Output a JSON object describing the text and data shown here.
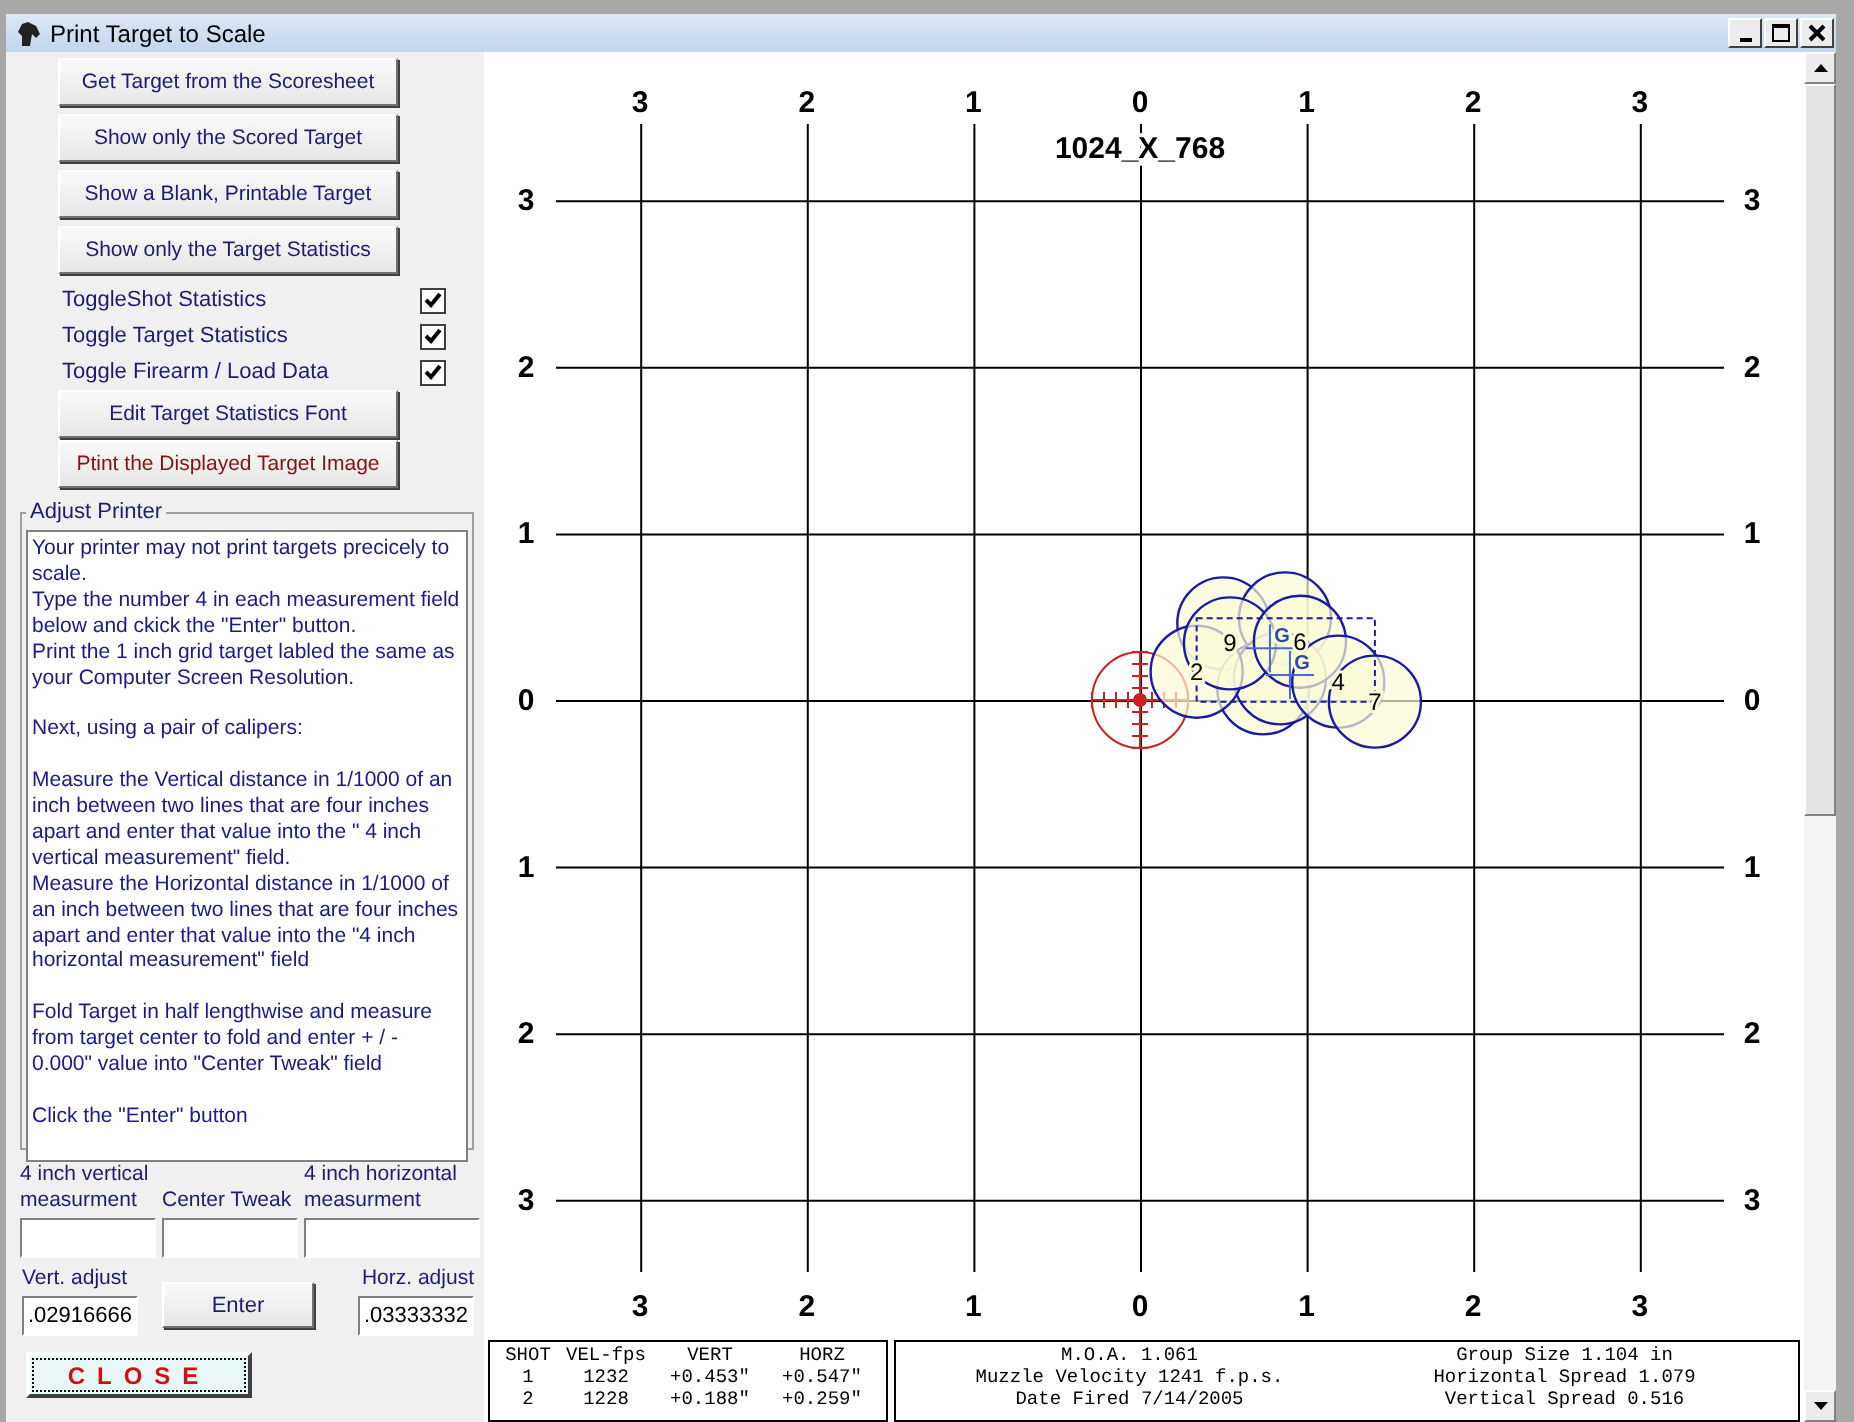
{
  "window": {
    "title": "Print Target to Scale"
  },
  "top_buttons": [
    {
      "label": "Get Target from the Scoresheet"
    },
    {
      "label": "Show only the Scored Target"
    },
    {
      "label": "Show a Blank, Printable Target"
    },
    {
      "label": "Show only the Target Statistics"
    }
  ],
  "toggles": [
    {
      "label": "ToggleShot Statistics",
      "checked": true
    },
    {
      "label": "Toggle Target Statistics",
      "checked": true
    },
    {
      "label": "Toggle Firearm / Load Data",
      "checked": true
    }
  ],
  "lower_buttons": [
    {
      "label": "Edit Target Statistics Font",
      "kind": "normal"
    },
    {
      "label": "Ptint the Displayed Target Image",
      "kind": "print"
    }
  ],
  "adjust_printer": {
    "title": "Adjust Printer",
    "instructions": [
      [
        "Your printer may not print targets precicely to scale.",
        "Type the number 4 in each measurement field below and ckick the \"Enter\" button.",
        "Print the 1 inch grid target labled the same as your Computer Screen Resolution."
      ],
      [
        "Next, using a pair of calipers:"
      ],
      [
        "Measure the Vertical distance in 1/1000 of an inch between two lines that are four inches apart and enter that value into the \" 4 inch vertical measurement\" field.",
        "Measure the Horizontal distance in 1/1000 of an inch between two lines that are four inches apart and enter that value into the \"4 inch horizontal measurement\" field"
      ],
      [
        "Fold Target in half lengthwise and measure from target center to fold and enter + / - 0.000\" value into \"Center Tweak\" field"
      ],
      [
        "Click the \"Enter\" button"
      ]
    ]
  },
  "measurements": {
    "vertical_label": "4 inch vertical measurment",
    "center_label": "Center Tweak",
    "horizontal_label": "4 inch horizontal measurment",
    "vert_adjust_label": "Vert. adjust",
    "vert_adjust_value": ".02916666",
    "enter_button": "Enter",
    "horz_adjust_label": "Horz. adjust",
    "horz_adjust_value": ".03333332"
  },
  "close_button": "CLOSE",
  "target": {
    "resolution_label": "1024_X_768",
    "top_labels": [
      "3",
      "2",
      "1",
      "0",
      "1",
      "2",
      "3"
    ],
    "bottom_labels": [
      "3",
      "2",
      "1",
      "0",
      "1",
      "2",
      "3"
    ],
    "left_labels": [
      "3",
      "2",
      "1",
      "0",
      "1",
      "2",
      "3"
    ],
    "right_labels": [
      "3",
      "2",
      "1",
      "0",
      "1",
      "2",
      "3"
    ],
    "shot_labels": [
      "2",
      "9",
      "6",
      "4",
      "7"
    ],
    "group_center_labels": [
      "G",
      "G"
    ]
  },
  "shot_table": {
    "columns": [
      "SHOT",
      "VEL-fps",
      "VERT",
      "HORZ"
    ],
    "rows": [
      [
        "1",
        "1232",
        "+0.453\"",
        "+0.547\""
      ],
      [
        "2",
        "1228",
        "+0.188\"",
        "+0.259\""
      ]
    ]
  },
  "group_stats": [
    [
      "M.O.A. 1.061",
      "Group Size 1.104 in"
    ],
    [
      "Muzzle Velocity 1241 f.p.s.",
      "Horizontal Spread 1.079"
    ],
    [
      "Date Fired 7/14/2005",
      "Vertical Spread 0.516"
    ]
  ]
}
